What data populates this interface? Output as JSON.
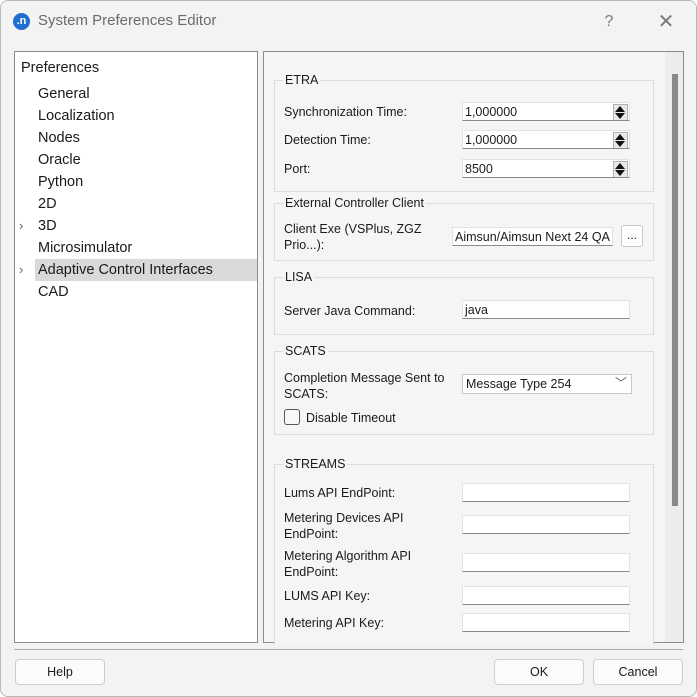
{
  "window": {
    "title": "System Preferences Editor",
    "app_icon_glyph": ".n",
    "help_glyph": "?",
    "close_glyph": "✕"
  },
  "tree": {
    "root": "Preferences",
    "items": [
      {
        "label": "General",
        "expandable": false,
        "selected": false
      },
      {
        "label": "Localization",
        "expandable": false,
        "selected": false
      },
      {
        "label": "Nodes",
        "expandable": false,
        "selected": false
      },
      {
        "label": "Oracle",
        "expandable": false,
        "selected": false
      },
      {
        "label": "Python",
        "expandable": false,
        "selected": false
      },
      {
        "label": "2D",
        "expandable": false,
        "selected": false
      },
      {
        "label": "3D",
        "expandable": true,
        "selected": false
      },
      {
        "label": "Microsimulator",
        "expandable": false,
        "selected": false
      },
      {
        "label": "Adaptive Control Interfaces",
        "expandable": true,
        "selected": true
      },
      {
        "label": "CAD",
        "expandable": false,
        "selected": false
      }
    ],
    "arrow_glyph": "›"
  },
  "etra": {
    "title": "ETRA",
    "sync_label": "Synchronization Time:",
    "sync_value": "1,000000",
    "detect_label": "Detection Time:",
    "detect_value": "1,000000",
    "port_label": "Port:",
    "port_value": "8500"
  },
  "ecc": {
    "title": "External Controller Client",
    "client_label_1": "Client Exe (VSPlus, ZGZ",
    "client_label_2": "Prio...):",
    "client_value": "Aimsun/Aimsun Next 24 QA",
    "browse_label": "..."
  },
  "lisa": {
    "title": "LISA",
    "java_label": "Server Java Command:",
    "java_value": "java"
  },
  "scats": {
    "title": "SCATS",
    "completion_label_1": "Completion Message Sent to",
    "completion_label_2": "SCATS:",
    "completion_value": "Message Type 254",
    "disable_timeout_label": "Disable Timeout",
    "disable_timeout_checked": false
  },
  "streams": {
    "title": "STREAMS",
    "lums_endpoint_label": "Lums API EndPoint:",
    "lums_endpoint_value": "",
    "metering_devices_label_1": "Metering Devices API",
    "metering_devices_label_2": "EndPoint:",
    "metering_devices_value": "",
    "metering_algorithm_label_1": "Metering Algorithm API",
    "metering_algorithm_label_2": "EndPoint:",
    "metering_algorithm_value": "",
    "lums_key_label": "LUMS API Key:",
    "lums_key_value": "",
    "metering_key_label": "Metering API Key:",
    "metering_key_value": ""
  },
  "footer": {
    "help_label": "Help",
    "ok_label": "OK",
    "cancel_label": "Cancel"
  }
}
